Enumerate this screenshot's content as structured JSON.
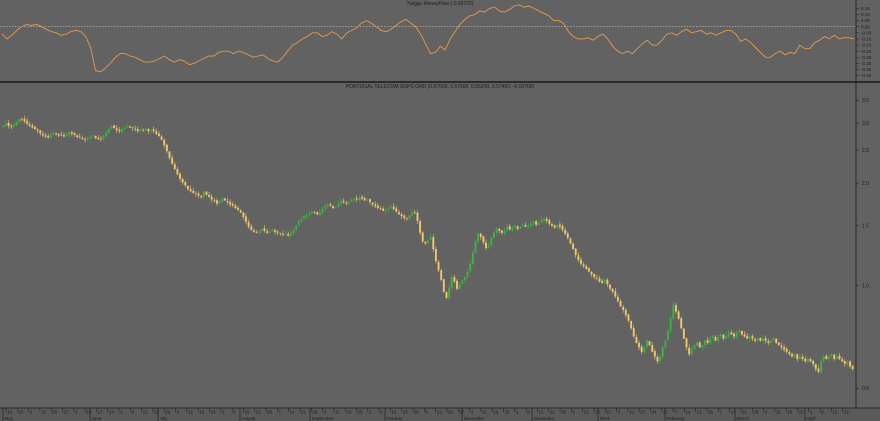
{
  "indicator_panel": {
    "title": "Twiggs MoneyFlow (-0.09722)",
    "line_color": "#e69a4c",
    "reference_value": 0.0,
    "y_ticks": [
      "0.15",
      "0.10",
      "0.05",
      "0.00",
      "-0.05",
      "-0.10",
      "-0.15",
      "-0.20",
      "-0.25",
      "-0.30",
      "-0.35",
      "-0.40"
    ]
  },
  "price_panel": {
    "title": "PORTUGAL TELECOM SGPS ORD (0.57500, 0.57500, 0.55200, 0.57400, -0.03700)",
    "up_color": "#3db341",
    "down_color": "#f2c76a",
    "y_ticks": [
      "3.5",
      "3.0",
      "2.5",
      "2.0",
      "1.5",
      "1.0",
      "0.5"
    ]
  },
  "x_axis": {
    "day_labels": [
      "14",
      "20",
      "6",
      "13",
      "20",
      "27",
      "3",
      "10",
      "17",
      "24",
      "1",
      "8",
      "15",
      "22",
      "29",
      "6",
      "12",
      "19",
      "26",
      "2",
      "9",
      "16",
      "23",
      "30",
      "7",
      "14",
      "21",
      "28",
      "4",
      "11",
      "18",
      "25",
      "2",
      "9",
      "16",
      "23",
      "30",
      "6",
      "13",
      "20",
      "27",
      "4",
      "11",
      "18",
      "25",
      "1",
      "8",
      "15",
      "22",
      "29",
      "6",
      "13",
      "20",
      "27",
      "3",
      "10",
      "17",
      "24",
      "31",
      "7",
      "14",
      "21",
      "28",
      "7",
      "14",
      "21",
      "28",
      "4",
      "11",
      "18",
      "25",
      "1",
      "8",
      "15",
      "22"
    ],
    "month_labels": [
      {
        "text": "May",
        "x": 3
      },
      {
        "text": "June",
        "x": 90
      },
      {
        "text": "July",
        "x": 158
      },
      {
        "text": "August",
        "x": 240
      },
      {
        "text": "September",
        "x": 310
      },
      {
        "text": "October",
        "x": 385
      },
      {
        "text": "November",
        "x": 462
      },
      {
        "text": "December",
        "x": 532
      },
      {
        "text": "2014",
        "x": 598
      },
      {
        "text": "February",
        "x": 665
      },
      {
        "text": "March",
        "x": 735
      },
      {
        "text": "April",
        "x": 805
      }
    ]
  },
  "chart_data": [
    {
      "type": "line",
      "title": "Twiggs MoneyFlow (-0.09722)",
      "series": [
        {
          "name": "Twiggs MoneyFlow",
          "values": [
            -0.06,
            -0.1,
            -0.07,
            -0.03,
            0.0,
            0.02,
            0.01,
            0.02,
            0.0,
            -0.02,
            -0.04,
            -0.05,
            -0.07,
            -0.06,
            -0.04,
            -0.03,
            -0.04,
            -0.08,
            -0.17,
            -0.36,
            -0.37,
            -0.34,
            -0.3,
            -0.25,
            -0.22,
            -0.22,
            -0.24,
            -0.25,
            -0.27,
            -0.29,
            -0.29,
            -0.28,
            -0.26,
            -0.24,
            -0.27,
            -0.29,
            -0.27,
            -0.28,
            -0.31,
            -0.3,
            -0.28,
            -0.26,
            -0.24,
            -0.24,
            -0.21,
            -0.2,
            -0.2,
            -0.22,
            -0.2,
            -0.21,
            -0.23,
            -0.25,
            -0.24,
            -0.23,
            -0.26,
            -0.28,
            -0.29,
            -0.25,
            -0.2,
            -0.15,
            -0.13,
            -0.1,
            -0.08,
            -0.05,
            -0.05,
            -0.08,
            -0.07,
            -0.04,
            -0.06,
            -0.1,
            -0.05,
            -0.03,
            -0.01,
            0.03,
            0.05,
            0.03,
            0.0,
            -0.03,
            -0.04,
            -0.02,
            0.01,
            0.04,
            0.06,
            0.03,
            0.0,
            -0.06,
            -0.14,
            -0.22,
            -0.21,
            -0.16,
            -0.19,
            -0.1,
            -0.04,
            0.02,
            0.06,
            0.09,
            0.1,
            0.13,
            0.12,
            0.15,
            0.16,
            0.13,
            0.12,
            0.14,
            0.17,
            0.18,
            0.16,
            0.17,
            0.15,
            0.13,
            0.11,
            0.09,
            0.05,
            0.05,
            0.03,
            -0.04,
            -0.08,
            -0.1,
            -0.1,
            -0.09,
            -0.11,
            -0.08,
            -0.06,
            -0.1,
            -0.16,
            -0.2,
            -0.22,
            -0.2,
            -0.22,
            -0.18,
            -0.14,
            -0.11,
            -0.15,
            -0.15,
            -0.11,
            -0.06,
            -0.05,
            -0.07,
            -0.04,
            -0.02,
            -0.05,
            -0.04,
            -0.03,
            -0.06,
            -0.05,
            -0.07,
            -0.05,
            -0.03,
            -0.03,
            -0.06,
            -0.12,
            -0.1,
            -0.13,
            -0.17,
            -0.21,
            -0.25,
            -0.25,
            -0.22,
            -0.2,
            -0.23,
            -0.21,
            -0.22,
            -0.15,
            -0.18,
            -0.18,
            -0.13,
            -0.11,
            -0.08,
            -0.1,
            -0.07,
            -0.1,
            -0.09,
            -0.09,
            -0.1
          ]
        }
      ],
      "ylim": [
        -0.42,
        0.17
      ],
      "reference_line": 0.0
    },
    {
      "type": "candlestick",
      "title": "PORTUGAL TELECOM SGPS ORD (0.57500, 0.57500, 0.55200, 0.57400, -0.03700)",
      "yscale": "log",
      "ylim": [
        0.45,
        3.7
      ],
      "close": [
        2.95,
        2.99,
        2.94,
        2.92,
        2.97,
        3.02,
        3.08,
        3.09,
        3.04,
        2.99,
        2.95,
        2.91,
        2.88,
        2.85,
        2.8,
        2.76,
        2.74,
        2.72,
        2.78,
        2.81,
        2.79,
        2.76,
        2.77,
        2.74,
        2.78,
        2.82,
        2.79,
        2.77,
        2.73,
        2.72,
        2.69,
        2.68,
        2.71,
        2.74,
        2.76,
        2.71,
        2.69,
        2.7,
        2.74,
        2.82,
        2.89,
        2.94,
        2.9,
        2.86,
        2.84,
        2.88,
        2.91,
        2.94,
        2.91,
        2.9,
        2.88,
        2.84,
        2.87,
        2.85,
        2.89,
        2.84,
        2.86,
        2.84,
        2.79,
        2.75,
        2.68,
        2.58,
        2.48,
        2.37,
        2.28,
        2.2,
        2.12,
        2.06,
        2.01,
        1.97,
        1.92,
        1.89,
        1.87,
        1.86,
        1.84,
        1.82,
        1.88,
        1.85,
        1.82,
        1.79,
        1.78,
        1.74,
        1.77,
        1.8,
        1.78,
        1.76,
        1.73,
        1.72,
        1.69,
        1.67,
        1.64,
        1.59,
        1.54,
        1.49,
        1.46,
        1.44,
        1.43,
        1.45,
        1.47,
        1.45,
        1.43,
        1.44,
        1.46,
        1.44,
        1.43,
        1.42,
        1.41,
        1.42,
        1.4,
        1.43,
        1.46,
        1.5,
        1.55,
        1.57,
        1.6,
        1.61,
        1.63,
        1.65,
        1.64,
        1.62,
        1.64,
        1.68,
        1.71,
        1.73,
        1.72,
        1.69,
        1.7,
        1.74,
        1.77,
        1.76,
        1.74,
        1.76,
        1.79,
        1.8,
        1.79,
        1.82,
        1.8,
        1.78,
        1.79,
        1.76,
        1.73,
        1.71,
        1.69,
        1.68,
        1.66,
        1.67,
        1.69,
        1.71,
        1.68,
        1.65,
        1.62,
        1.6,
        1.58,
        1.57,
        1.61,
        1.64,
        1.63,
        1.55,
        1.43,
        1.35,
        1.33,
        1.36,
        1.39,
        1.28,
        1.18,
        1.11,
        1.04,
        0.96,
        0.92,
        0.99,
        1.06,
        1.03,
        0.98,
        1.01,
        1.04,
        1.06,
        1.1,
        1.16,
        1.25,
        1.35,
        1.42,
        1.39,
        1.34,
        1.29,
        1.32,
        1.38,
        1.43,
        1.47,
        1.45,
        1.43,
        1.45,
        1.49,
        1.46,
        1.48,
        1.5,
        1.47,
        1.49,
        1.51,
        1.49,
        1.5,
        1.52,
        1.54,
        1.51,
        1.53,
        1.56,
        1.57,
        1.55,
        1.52,
        1.5,
        1.48,
        1.51,
        1.49,
        1.46,
        1.42,
        1.38,
        1.33,
        1.28,
        1.23,
        1.19,
        1.16,
        1.14,
        1.12,
        1.1,
        1.08,
        1.06,
        1.05,
        1.03,
        1.02,
        1.04,
        1.01,
        0.98,
        0.96,
        0.93,
        0.9,
        0.87,
        0.85,
        0.82,
        0.79,
        0.75,
        0.71,
        0.68,
        0.66,
        0.64,
        0.66,
        0.69,
        0.67,
        0.64,
        0.62,
        0.6,
        0.62,
        0.66,
        0.69,
        0.74,
        0.8,
        0.88,
        0.84,
        0.8,
        0.75,
        0.7,
        0.66,
        0.63,
        0.65,
        0.67,
        0.68,
        0.66,
        0.67,
        0.69,
        0.68,
        0.7,
        0.71,
        0.69,
        0.71,
        0.72,
        0.7,
        0.71,
        0.73,
        0.72,
        0.71,
        0.73,
        0.74,
        0.72,
        0.71,
        0.7,
        0.71,
        0.7,
        0.69,
        0.7,
        0.69,
        0.7,
        0.69,
        0.68,
        0.69,
        0.7,
        0.68,
        0.67,
        0.66,
        0.65,
        0.64,
        0.63,
        0.62,
        0.63,
        0.61,
        0.62,
        0.61,
        0.6,
        0.61,
        0.6,
        0.59,
        0.57,
        0.56,
        0.6,
        0.62,
        0.61,
        0.62,
        0.63,
        0.61,
        0.62,
        0.61,
        0.6,
        0.59,
        0.6,
        0.58,
        0.57
      ]
    }
  ]
}
